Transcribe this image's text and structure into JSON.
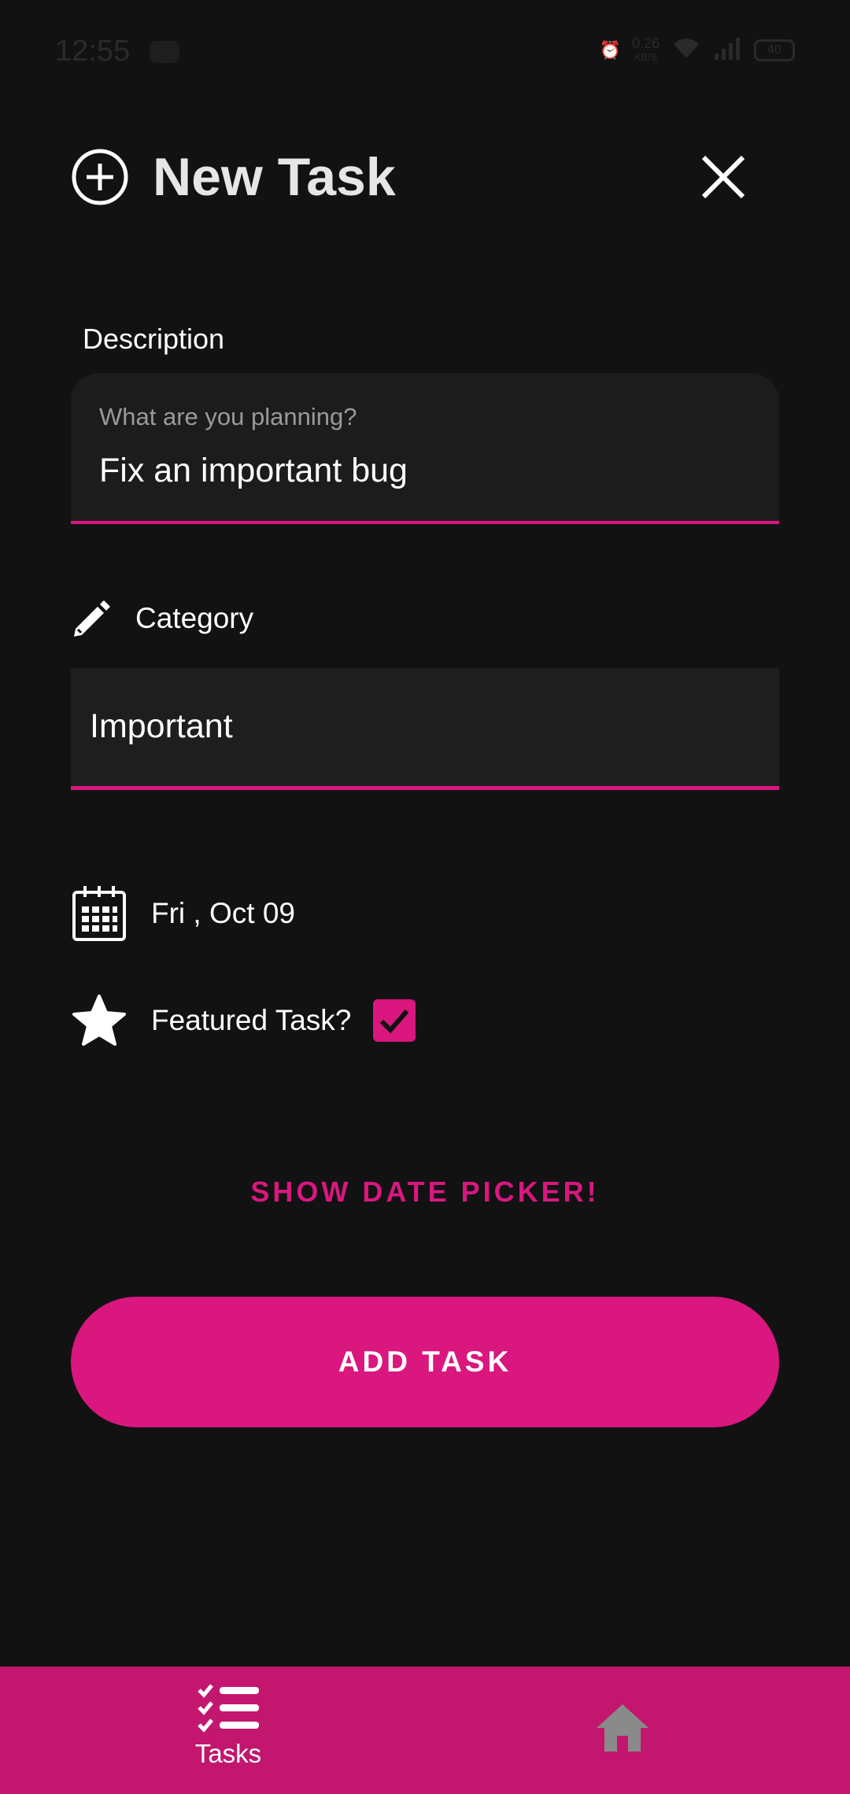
{
  "status_bar": {
    "time": "12:55",
    "network_speed_value": "0.26",
    "network_speed_unit": "KB/S",
    "battery": "40"
  },
  "header": {
    "title": "New Task"
  },
  "description": {
    "label": "Description",
    "hint": "What are you planning?",
    "value": "Fix an important bug"
  },
  "category": {
    "label": "Category",
    "value": "Important"
  },
  "date": {
    "text": "Fri , Oct 09"
  },
  "featured": {
    "label": "Featured Task?",
    "checked": true
  },
  "actions": {
    "show_date_picker": "SHOW DATE PICKER!",
    "add_task": "ADD TASK"
  },
  "bottom_nav": {
    "tasks_label": "Tasks"
  },
  "colors": {
    "accent": "#d9177f",
    "nav_background": "#c2166f",
    "background": "#121212",
    "field_background": "#1c1c1c",
    "inactive_icon": "#8a8a8a"
  },
  "icons": {
    "header": "add-circle-icon",
    "close": "close-icon",
    "category": "pencil-icon",
    "date": "calendar-icon",
    "featured": "star-icon",
    "checkbox": "check-icon",
    "nav_tasks": "task-list-icon",
    "nav_home": "home-icon"
  }
}
